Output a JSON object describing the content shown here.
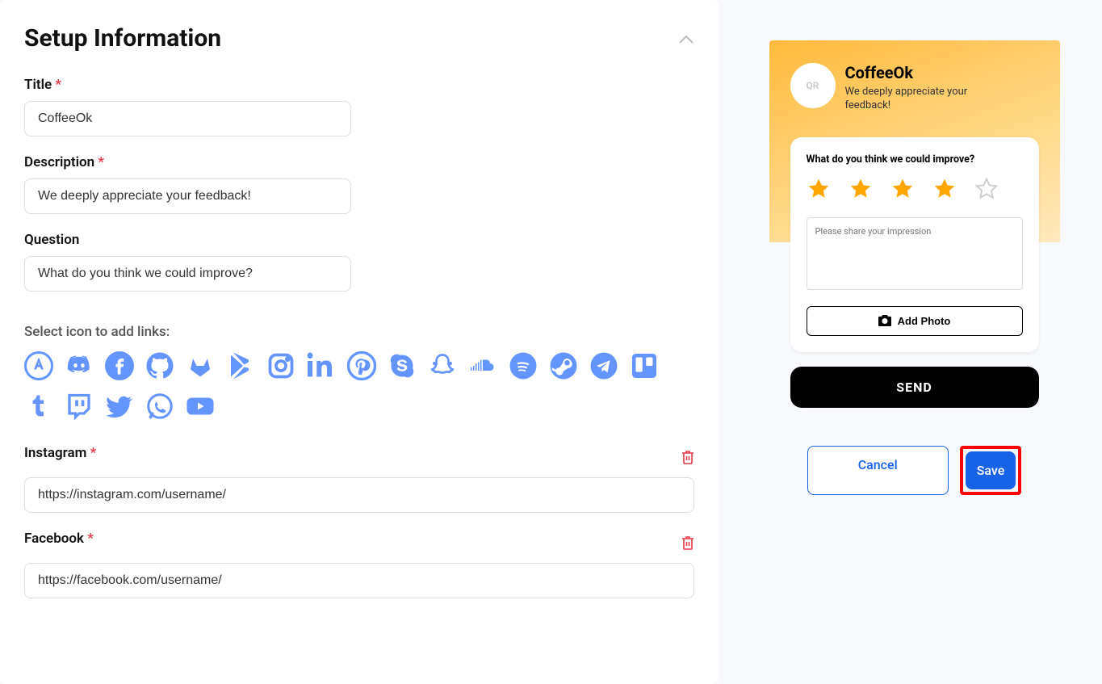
{
  "section": {
    "title": "Setup Information"
  },
  "form": {
    "title_label": "Title",
    "title_value": "CoffeeOk",
    "desc_label": "Description",
    "desc_value": "We deeply appreciate your feedback!",
    "question_label": "Question",
    "question_value": "What do you think we could improve?",
    "icons_label": "Select icon to add links:"
  },
  "links": [
    {
      "label": "Instagram",
      "value": "https://instagram.com/username/"
    },
    {
      "label": "Facebook",
      "value": "https://facebook.com/username/"
    }
  ],
  "preview": {
    "avatar_text": "QR",
    "title": "CoffeeOk",
    "desc": "We deeply appreciate your feedback!",
    "question": "What do you think we could improve?",
    "textarea_placeholder": "Please share your impression",
    "add_photo": "Add Photo",
    "send": "SEND",
    "rating": 4
  },
  "actions": {
    "cancel": "Cancel",
    "save": "Save"
  }
}
